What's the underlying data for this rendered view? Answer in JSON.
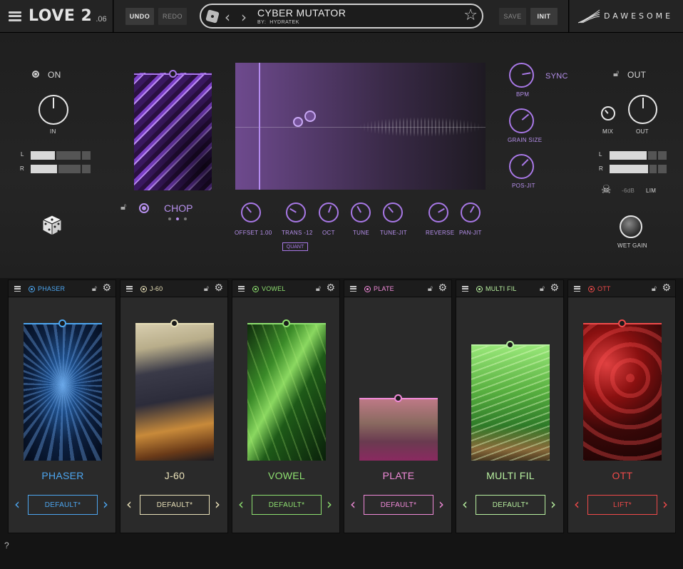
{
  "app": {
    "name": "LOVE 2",
    "version": ".06",
    "brand": "DAWESOME"
  },
  "toolbar": {
    "undo": "UNDO",
    "redo": "REDO",
    "save": "SAVE",
    "init": "INIT"
  },
  "preset": {
    "name": "CYBER MUTATOR",
    "by_label": "BY:",
    "author": "HYDRATEK"
  },
  "input": {
    "power_label": "ON",
    "knob_label": "IN",
    "meter_l": "L",
    "meter_r": "R"
  },
  "output": {
    "power_label": "OUT",
    "mix_label": "MIX",
    "out_label": "OUT",
    "meter_l": "L",
    "meter_r": "R",
    "limit_db": "-6dB",
    "lim_label": "LIM",
    "wet_gain_label": "WET GAIN"
  },
  "chop": {
    "label": "CHOP"
  },
  "grain": {
    "bpm_label": "BPM",
    "sync_label": "SYNC",
    "grain_size_label": "GRAIN SIZE",
    "pos_jit_label": "POS-JIT"
  },
  "params": [
    {
      "label": "OFFSET 1.00"
    },
    {
      "label": "TRANS -12"
    },
    {
      "label": "OCT"
    },
    {
      "label": "TUNE"
    },
    {
      "label": "TUNE-JIT"
    },
    {
      "label": "REVERSE"
    },
    {
      "label": "PAN-JIT"
    }
  ],
  "quant_label": "QUANT",
  "modules": [
    {
      "title": "PHASER",
      "name": "PHASER",
      "preset": "DEFAULT*",
      "color": "#4da6f0"
    },
    {
      "title": "J-60",
      "name": "J-60",
      "preset": "DEFAULT*",
      "color": "#e8e0b8"
    },
    {
      "title": "VOWEL",
      "name": "VOWEL",
      "preset": "DEFAULT*",
      "color": "#8ee070"
    },
    {
      "title": "PLATE",
      "name": "PLATE",
      "preset": "DEFAULT*",
      "color": "#f08ad8"
    },
    {
      "title": "MULTI FIL",
      "name": "MULTI FIL",
      "preset": "DEFAULT*",
      "color": "#b8f0a0"
    },
    {
      "title": "OTT",
      "name": "OTT",
      "preset": "LIFT*",
      "color": "#f04a4a"
    }
  ],
  "help": "?"
}
